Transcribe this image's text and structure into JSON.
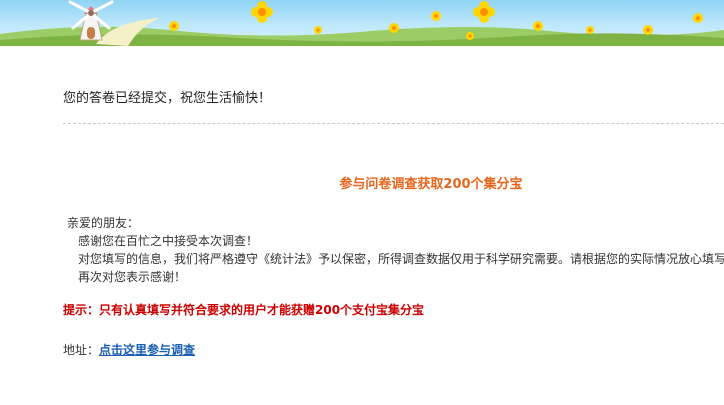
{
  "banner": {
    "colors": {
      "sky": "#a8def8",
      "hill": "#8bc34a",
      "path": "#f6f0c8",
      "flower": "#ffd600"
    },
    "icons": [
      "windmill-icon",
      "flower-icon"
    ]
  },
  "main": {
    "success_message": "您的答卷已经提交，祝您生活愉快！",
    "promo_title": "参与问卷调查获取200个集分宝",
    "letter": {
      "greeting": "亲爱的朋友：",
      "lines": [
        "感谢您在百忙之中接受本次调查！",
        "对您填写的信息，我们将严格遵守《统计法》予以保密，所得调查数据仅用于科学研究需要。请根据您的实际情况放心填写",
        "再次对您表示感谢！"
      ]
    },
    "tip": "提示：只有认真填写并符合要求的用户才能获赠200个支付宝集分宝",
    "address": {
      "label": "地址：",
      "link_text": "点击这里参与调查"
    }
  },
  "colors": {
    "promo_title": "#e8661c",
    "tip": "#cc0000",
    "link": "#1a5fb4"
  }
}
